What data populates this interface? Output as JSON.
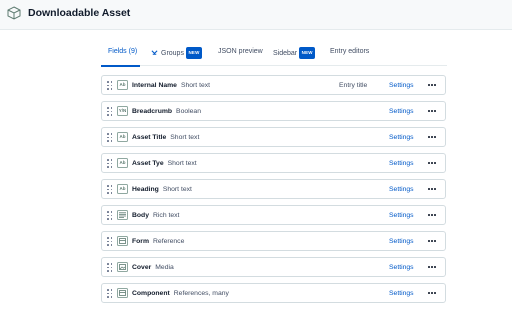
{
  "header": {
    "title": "Downloadable Asset",
    "icon": "content-type-icon"
  },
  "tabs": [
    {
      "label": "Fields (9)",
      "active": true
    },
    {
      "label": "Groups",
      "badge": "NEW",
      "icon": "groups-icon"
    },
    {
      "label": "JSON preview"
    },
    {
      "label": "Sidebar",
      "badge": "NEW"
    },
    {
      "label": "Entry editors"
    }
  ],
  "fields": [
    {
      "name": "Internal Name",
      "type": "Short text",
      "type_icon": "Ab",
      "entry_title": "Entry title",
      "settings": "Settings"
    },
    {
      "name": "Breadcrumb",
      "type": "Boolean",
      "type_icon": "Y/N",
      "settings": "Settings"
    },
    {
      "name": "Asset Title",
      "type": "Short text",
      "type_icon": "Ab",
      "settings": "Settings"
    },
    {
      "name": "Asset Tye",
      "type": "Short text",
      "type_icon": "Ab",
      "settings": "Settings"
    },
    {
      "name": "Heading",
      "type": "Short text",
      "type_icon": "Ab",
      "settings": "Settings"
    },
    {
      "name": "Body",
      "type": "Rich text",
      "type_icon": "rich-text-icon",
      "settings": "Settings"
    },
    {
      "name": "Form",
      "type": "Reference",
      "type_icon": "reference-icon",
      "settings": "Settings"
    },
    {
      "name": "Cover",
      "type": "Media",
      "type_icon": "media-icon",
      "settings": "Settings"
    },
    {
      "name": "Component",
      "type": "References, many",
      "type_icon": "reference-icon",
      "settings": "Settings"
    }
  ],
  "colors": {
    "accent": "#0059c8",
    "text": "#111b2b",
    "muted": "#414d63",
    "border": "#d3dce0"
  }
}
